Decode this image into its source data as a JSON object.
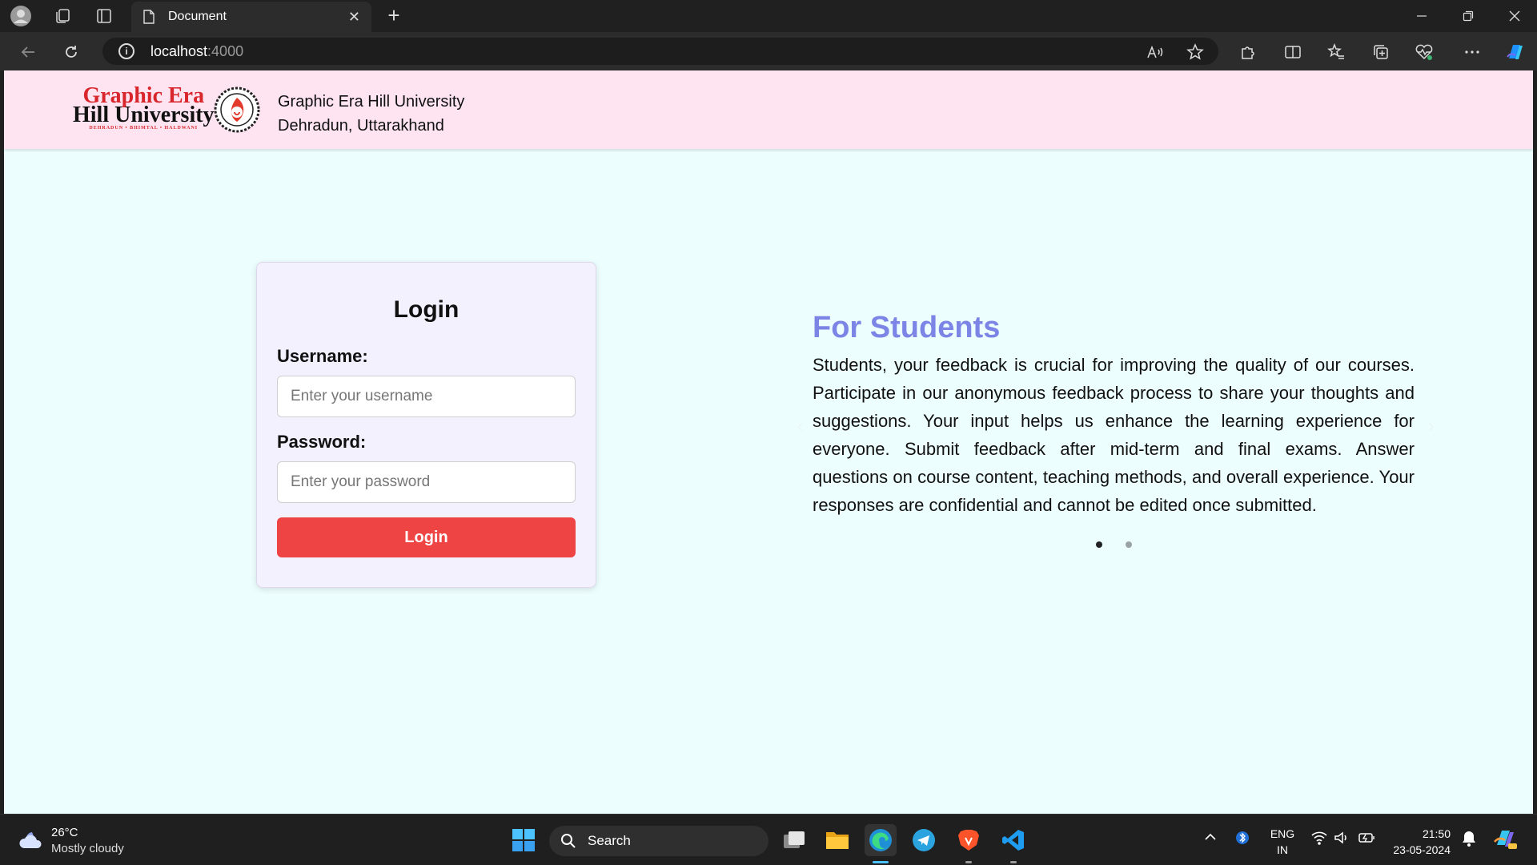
{
  "browser": {
    "tab_title": "Document",
    "url_host": "localhost",
    "url_port": ":4000"
  },
  "header": {
    "logo_line1": "Graphic Era",
    "logo_line2": "Hill University",
    "logo_sub": "DEHRADUN • BHIMTAL • HALDWANI",
    "university_name": "Graphic Era Hill University",
    "university_location": "Dehradun, Uttarakhand"
  },
  "login": {
    "title": "Login",
    "username_label": "Username:",
    "username_placeholder": "Enter your username",
    "password_label": "Password:",
    "password_placeholder": "Enter your password",
    "button_label": "Login"
  },
  "carousel": {
    "title": "For Students",
    "text": "Students, your feedback is crucial for improving the quality of our courses. Participate in our anonymous feedback process to share your thoughts and suggestions. Your input helps us enhance the learning experience for everyone. Submit feedback after mid-term and final exams. Answer questions on course content, teaching methods, and overall experience. Your responses are confidential and cannot be edited once submitted.",
    "active_slide": 1,
    "slide_count": 2
  },
  "taskbar": {
    "weather_temp": "26°C",
    "weather_desc": "Mostly cloudy",
    "search_label": "Search",
    "lang_line1": "ENG",
    "lang_line2": "IN",
    "time": "21:50",
    "date": "23-05-2024"
  },
  "colors": {
    "header_bg": "#fde4f0",
    "page_bg": "#edfefe",
    "card_bg": "#f4f1fe",
    "login_button": "#ef4444",
    "carousel_title": "#7c85e6"
  }
}
